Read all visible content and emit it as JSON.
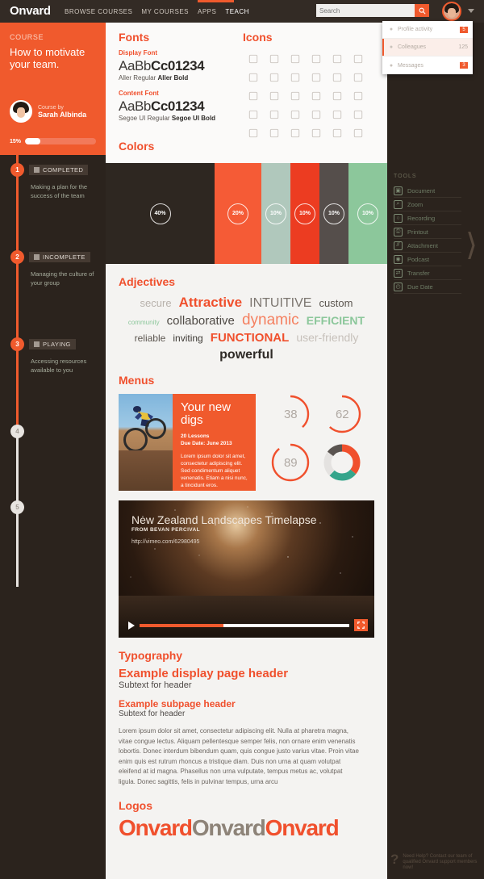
{
  "brand": "Onvard",
  "nav": {
    "links": [
      {
        "label": "BROWSE COURSES",
        "active": false
      },
      {
        "label": "MY COURSES",
        "active": false
      },
      {
        "label": "APPS",
        "active": false
      },
      {
        "label": "TEACH",
        "active": true
      }
    ],
    "search_placeholder": "Search",
    "search_value": "",
    "search_icon": "search-icon"
  },
  "dropdown": {
    "items": [
      {
        "label": "Profile activity",
        "badge": "5",
        "count": "",
        "icon": "star-icon",
        "selected": false
      },
      {
        "label": "Colleagues",
        "badge": "",
        "count": "125",
        "icon": "user-icon",
        "selected": true
      },
      {
        "label": "Messages",
        "badge": "3",
        "count": "",
        "icon": "mail-icon",
        "selected": false
      }
    ]
  },
  "course": {
    "kicker": "COURSE",
    "title": "How to motivate your team.",
    "by_label": "Course by",
    "author": "Sarah Albinda",
    "progress_pct": "15%"
  },
  "steps": [
    {
      "num": "1",
      "tag": "COMPLETED",
      "desc": "Making a plan for the success of the team",
      "active": true
    },
    {
      "num": "2",
      "tag": "INCOMPLETE",
      "desc": "Managing the culture of your group",
      "active": true
    },
    {
      "num": "3",
      "tag": "PLAYING",
      "desc": "Accessing resources available to you",
      "active": true
    },
    {
      "num": "4",
      "tag": "",
      "desc": "",
      "active": false
    },
    {
      "num": "5",
      "tag": "",
      "desc": "",
      "active": false
    }
  ],
  "tools": {
    "header": "TOOLS",
    "items": [
      {
        "label": "Document",
        "icon": "document-icon",
        "glyph": "▣"
      },
      {
        "label": "Zoom",
        "icon": "zoom-icon",
        "glyph": "⌕"
      },
      {
        "label": "Recording",
        "icon": "recording-icon",
        "glyph": "○"
      },
      {
        "label": "Printout",
        "icon": "printer-icon",
        "glyph": "⎙"
      },
      {
        "label": "Attachment",
        "icon": "paperclip-icon",
        "glyph": "⫻"
      },
      {
        "label": "Podcast",
        "icon": "podcast-icon",
        "glyph": "◉"
      },
      {
        "label": "Transfer",
        "icon": "transfer-icon",
        "glyph": "⇄"
      },
      {
        "label": "Due Date",
        "icon": "clock-icon",
        "glyph": "◴"
      }
    ]
  },
  "help": {
    "icon": "question-icon",
    "text": "Need Help? Contact our team of qualified Onvard support members now!"
  },
  "fonts": {
    "header": "Fonts",
    "display_label": "Display Font",
    "display_sample_regular": "AaBb",
    "display_sample_bold": "Cc01234",
    "display_caption_regular": "Aller Regular ",
    "display_caption_bold": "Aller Bold",
    "content_label": "Content Font",
    "content_sample_regular": "AaBb",
    "content_sample_bold": "Cc01234",
    "content_caption_regular": "Segoe UI Regular ",
    "content_caption_bold": "Segoe UI Bold"
  },
  "icons": {
    "header": "Icons",
    "grid": [
      "volume-mute-icon",
      "volume-low-icon",
      "volume-high-icon",
      "brightness-high-icon",
      "brightness-low-icon",
      "contrast-icon",
      "comment-icon",
      "comment-alt-icon",
      "window-icon",
      "window-add-icon",
      "window-remove-icon",
      "window-close-icon",
      "folder-icon",
      "book-icon",
      "book-open-icon",
      "page-icon",
      "page-search-icon",
      "page-download-icon",
      "zoom-in-icon",
      "zoom-out-icon",
      "eye-icon",
      "eye-target-icon",
      "pin-icon",
      "wifi-icon",
      "square-icon",
      "note-icon",
      "copy-icon",
      "crop-icon",
      "lightbulb-icon",
      "bulb-outline-icon"
    ]
  },
  "colors": {
    "header": "Colors",
    "swatches": [
      {
        "pct": "40%",
        "hex": "#2e2721"
      },
      {
        "pct": "20%",
        "hex": "#f55b36"
      },
      {
        "pct": "10%",
        "hex": "#b0c8bc"
      },
      {
        "pct": "10%",
        "hex": "#ec3c21"
      },
      {
        "pct": "10%",
        "hex": "#554e4b"
      },
      {
        "pct": "10%",
        "hex": "#8cc79b"
      }
    ]
  },
  "adjectives": {
    "header": "Adjectives",
    "words": [
      {
        "text": "secure",
        "size": 13,
        "color": "#b8b2ac",
        "weight": "400"
      },
      {
        "text": "Attractive",
        "size": 17,
        "color": "#f0502d",
        "weight": "700"
      },
      {
        "text": "INTUITIVE",
        "size": 16,
        "color": "#7c7670",
        "weight": "300"
      },
      {
        "text": "custom",
        "size": 13,
        "color": "#5c5650",
        "weight": "400"
      },
      {
        "text": "community",
        "size": 8,
        "color": "#8cc79b",
        "weight": "400"
      },
      {
        "text": "collaborative",
        "size": 15,
        "color": "#4e4944",
        "weight": "400"
      },
      {
        "text": "dynamic",
        "size": 19,
        "color": "#f58060",
        "weight": "300"
      },
      {
        "text": "EFFICIENT",
        "size": 14,
        "color": "#8cc79b",
        "weight": "700"
      },
      {
        "text": "reliable",
        "size": 12,
        "color": "#5c5650",
        "weight": "400"
      },
      {
        "text": "inviting",
        "size": 12,
        "color": "#3d3934",
        "weight": "400"
      },
      {
        "text": "FUNCTIONAL",
        "size": 15,
        "color": "#f0502d",
        "weight": "700"
      },
      {
        "text": "user-friendly",
        "size": 14,
        "color": "#c7c1bb",
        "weight": "400"
      },
      {
        "text": "powerful",
        "size": 16,
        "color": "#2e2a26",
        "weight": "700"
      }
    ]
  },
  "menus": {
    "header": "Menus",
    "card": {
      "image": "cyclist-photo",
      "title": "Your new digs",
      "lessons": "20 Lessons",
      "due": "Due Date: June 2013",
      "body": "Lorem ipsum dolor sit amet, consectetur adipiscing elit. Sed condimentum aliquet venenatis. Etiam a nisi nunc, a tincidunt eros."
    }
  },
  "chart_data": [
    {
      "type": "pie",
      "title": "38",
      "value": 38,
      "max": 100,
      "color": "#f0502d",
      "track": "transparent",
      "label": "38"
    },
    {
      "type": "pie",
      "title": "62",
      "value": 62,
      "max": 100,
      "color": "#f0502d",
      "track": "transparent",
      "label": "62"
    },
    {
      "type": "pie",
      "title": "89",
      "value": 89,
      "max": 100,
      "color": "#f0502d",
      "track": "transparent",
      "label": "89"
    },
    {
      "type": "pie",
      "title": "Segmented donut",
      "segments": [
        {
          "name": "orange",
          "value": 36,
          "color": "#f0502d"
        },
        {
          "name": "teal",
          "value": 26,
          "color": "#35a58b"
        },
        {
          "name": "light-gray",
          "value": 23,
          "color": "#e4e2e0"
        },
        {
          "name": "dark-gray",
          "value": 15,
          "color": "#5a5450"
        }
      ]
    }
  ],
  "video": {
    "title": "New Zealand Landscapes Timelapse",
    "subtitle": "FROM BEVAN PERCIVAL",
    "url": "http://vimeo.com/62980495",
    "play_icon": "play-icon",
    "fullscreen_icon": "fullscreen-icon",
    "progress_pct": 40
  },
  "typography": {
    "header": "Typography",
    "display_header": "Example display page header",
    "display_sub": "Subtext for header",
    "subpage_header": "Example subpage header",
    "subpage_sub": "Subtext for header",
    "paragraph": "Lorem ipsum dolor sit amet, consectetur adipiscing elit. Nulla at pharetra magna, vitae congue lectus. Aliquam pellentesque semper felis, non ornare enim venenatis lobortis. Donec interdum bibendum quam, quis congue justo varius vitae. Proin vitae enim quis est rutrum rhoncus a tristique diam. Duis non urna at quam volutpat eleifend at id magna. Phasellus non urna vulputate, tempus metus ac, volutpat ligula. Donec sagittis, felis in pulvinar tempus, urna arcu"
  },
  "logos": {
    "header": "Logos",
    "variants": [
      {
        "text": "Onvard",
        "color": "#f0502d"
      },
      {
        "text": "Onvard",
        "color": "#8d8378"
      },
      {
        "text": "Onvard",
        "color": "#f0502d"
      }
    ]
  }
}
